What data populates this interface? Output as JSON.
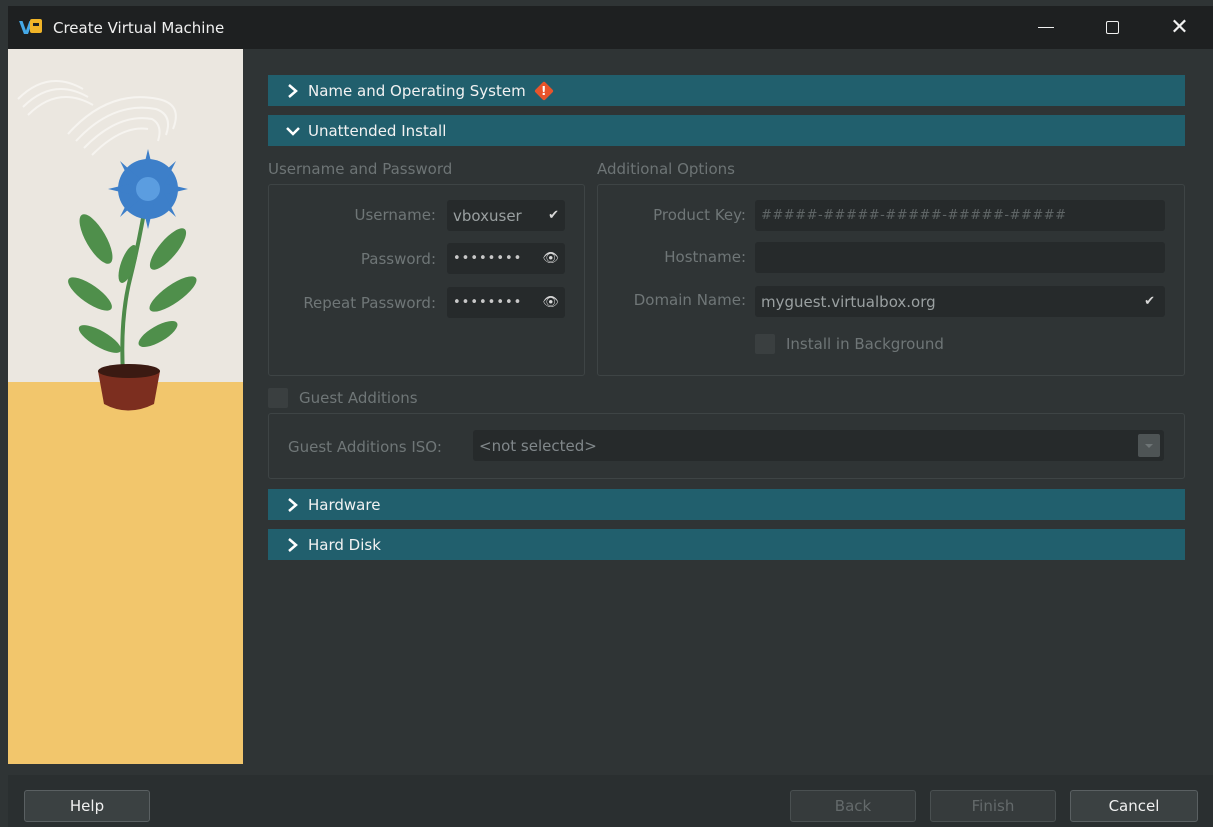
{
  "window": {
    "title": "Create Virtual Machine"
  },
  "sections": {
    "name_os": {
      "label": "Name and Operating System",
      "expanded": false
    },
    "unattended": {
      "label": "Unattended Install",
      "expanded": true
    },
    "hardware": {
      "label": "Hardware",
      "expanded": false
    },
    "hard_disk": {
      "label": "Hard Disk",
      "expanded": false
    }
  },
  "credentials": {
    "group_title": "Username and Password",
    "username_label": "Username:",
    "username_value": "vboxuser",
    "password_label": "Password:",
    "password_value": "••••••••",
    "repeat_label": "Repeat Password:",
    "repeat_value": "••••••••"
  },
  "additional": {
    "group_title": "Additional Options",
    "product_key_label": "Product Key:",
    "product_key_placeholder": "#####-#####-#####-#####-#####",
    "hostname_label": "Hostname:",
    "hostname_value": "",
    "domain_label": "Domain Name:",
    "domain_value": "myguest.virtualbox.org",
    "install_bg_label": "Install in Background",
    "install_bg_checked": false
  },
  "guest_additions": {
    "label": "Guest Additions",
    "checked": false,
    "iso_label": "Guest Additions ISO:",
    "iso_value": "<not selected>"
  },
  "footer": {
    "help": "Help",
    "back": "Back",
    "finish": "Finish",
    "cancel": "Cancel"
  },
  "colors": {
    "section_header": "#215f6d",
    "background": "#2f3435",
    "warning": "#e8542b"
  }
}
